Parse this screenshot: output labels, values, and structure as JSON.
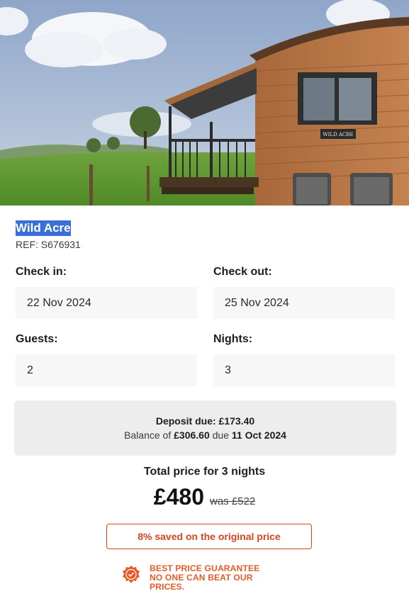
{
  "property": {
    "name": "Wild Acre",
    "ref": "REF: S676931",
    "sign_text": "WILD ACRE"
  },
  "booking": {
    "check_in_label": "Check in:",
    "check_in_value": "22 Nov 2024",
    "check_out_label": "Check out:",
    "check_out_value": "25 Nov 2024",
    "guests_label": "Guests:",
    "guests_value": "2",
    "nights_label": "Nights:",
    "nights_value": "3"
  },
  "deposit": {
    "due_prefix": "Deposit due:",
    "due_amount": "£173.40",
    "balance_prefix": "Balance of",
    "balance_amount": "£306.60",
    "balance_mid": "due",
    "balance_date": "11 Oct 2024"
  },
  "pricing": {
    "total_label": "Total price for 3 nights",
    "price": "£480",
    "was_price": "was £522",
    "saved_text": "8% saved on the original price"
  },
  "guarantee": {
    "line1": "BEST PRICE GUARANTEE",
    "line2": "NO ONE CAN BEAT OUR",
    "line3": "PRICES."
  },
  "colors": {
    "accent": "#d9461c",
    "highlight": "#3a6fd8",
    "field_bg": "#f7f7f7",
    "deposit_bg": "#ededed"
  },
  "icons": {
    "guarantee": "price-guarantee-badge-icon"
  }
}
